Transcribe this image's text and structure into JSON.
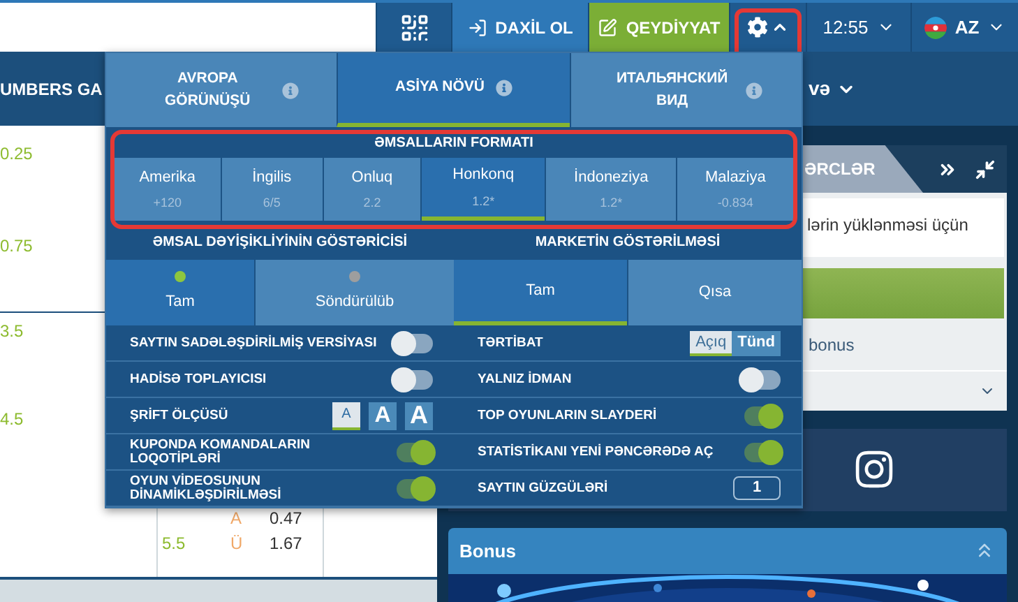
{
  "top_bar": {
    "buttons": [
      {
        "kind": "qr"
      },
      {
        "kind": "login",
        "label": "DAXİL OL"
      },
      {
        "kind": "register",
        "label": "QEYDİYYAT"
      },
      {
        "kind": "settings",
        "expanded": true
      },
      {
        "kind": "time",
        "label": "12:55"
      },
      {
        "kind": "language",
        "label": "AZ"
      }
    ]
  },
  "nav_bar": {
    "left_text": "UMBERS GA",
    "right_text": "və"
  },
  "odds_table": {
    "upper_rows": [
      "0.25",
      "0.75"
    ],
    "lower_rows": [
      "3.5",
      "4.5"
    ],
    "bottom_rows": [
      {
        "column_2": "",
        "column_3": "A",
        "column_4": "0.47"
      },
      {
        "column_2": "5.5",
        "column_3": "Ü",
        "column_4": "1.67"
      }
    ]
  },
  "side_widget": {
    "tab": "ƏRCLƏR",
    "message": "lərin yüklənməsi üçün",
    "bonus_text": "bonus"
  },
  "bonus_panel": {
    "title": "Bonus"
  },
  "settings_menu": {
    "view_tabs": [
      {
        "label": "AVROPA GÖRÜNÜŞÜ",
        "selected": false
      },
      {
        "label": "ASİYA NÖVÜ",
        "selected": true
      },
      {
        "label": "ИТАЛЬЯНСКИЙ ВИД",
        "selected": false
      }
    ],
    "odds_format": {
      "title": "ƏMSALLARIN FORMATI",
      "options": [
        {
          "label": "Amerika",
          "example": "+120",
          "selected": false
        },
        {
          "label": "İngilis",
          "example": "6/5",
          "selected": false
        },
        {
          "label": "Onluq",
          "example": "2.2",
          "selected": false
        },
        {
          "label": "Honkonq",
          "example": "1.2*",
          "selected": true
        },
        {
          "label": "İndoneziya",
          "example": "1.2*",
          "selected": false
        },
        {
          "label": "Malaziya",
          "example": "-0.834",
          "selected": false
        }
      ]
    },
    "odds_change": {
      "title": "ƏMSAL DƏYİŞİKLİYİNİN GÖSTƏRİCİSİ",
      "options": [
        {
          "label": "Tam",
          "selected": true
        },
        {
          "label": "Söndürülüb",
          "selected": false
        }
      ]
    },
    "market_display": {
      "title": "MARKETİN GÖSTƏRİLMƏSİ",
      "options": [
        {
          "label": "Tam",
          "selected": true
        },
        {
          "label": "Qısa",
          "selected": false
        }
      ]
    },
    "left_settings": [
      {
        "kind": "toggle",
        "label": "SAYTIN SADƏLƏŞDİRİLMİŞ VERSİYASI",
        "on": false
      },
      {
        "kind": "toggle",
        "label": "HADİSƏ TOPLAYICISI",
        "on": false
      },
      {
        "kind": "font_size",
        "label": "ŞRİFT ÖLÇÜSÜ",
        "options": [
          {
            "label": "A",
            "selected": true
          },
          {
            "label": "A",
            "selected": false
          },
          {
            "label": "A",
            "selected": false
          }
        ]
      },
      {
        "kind": "toggle",
        "label": "KUPONDA KOMANDALARIN LOQOTİPLƏRİ",
        "on": true
      },
      {
        "kind": "toggle",
        "label": "OYUN VİDEOSUNUN DİNAMİKLƏŞDİRİLMƏSİ",
        "on": true
      }
    ],
    "right_settings": [
      {
        "kind": "theme",
        "label": "TƏRTİBAT",
        "options": [
          {
            "label": "Açıq",
            "selected": true
          },
          {
            "label": "Tünd",
            "selected": false
          }
        ]
      },
      {
        "kind": "toggle",
        "label": "YALNIZ İDMAN",
        "on": false
      },
      {
        "kind": "toggle",
        "label": "TOP OYUNLARIN SLAYDERİ",
        "on": true
      },
      {
        "kind": "toggle",
        "label": "STATİSTİKANI YENİ PƏNCƏRƏDƏ AÇ",
        "on": true
      },
      {
        "kind": "counter",
        "label": "SAYTIN GÜZGÜLƏRİ",
        "value": "1"
      }
    ]
  }
}
